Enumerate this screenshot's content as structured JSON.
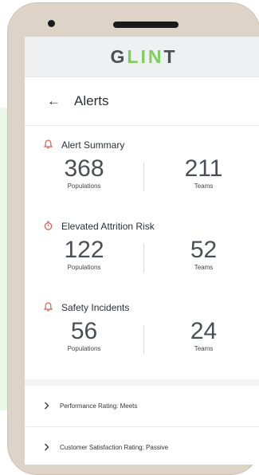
{
  "brand": {
    "logo": "GLINT"
  },
  "header": {
    "back_icon": "←",
    "title": "Alerts"
  },
  "sections": [
    {
      "title": "Alert Summary",
      "icon": "bell-icon",
      "populations": "368",
      "populations_label": "Populations",
      "teams": "211",
      "teams_label": "Teams"
    },
    {
      "title": "Elevated Attrition Risk",
      "icon": "stopwatch-icon",
      "populations": "122",
      "populations_label": "Populations",
      "teams": "52",
      "teams_label": "Teams"
    },
    {
      "title": "Safety Incidents",
      "icon": "bell-icon",
      "populations": "56",
      "populations_label": "Populations",
      "teams": "24",
      "teams_label": "Teams"
    }
  ],
  "rows": [
    {
      "label": "Performance Rating: Meets"
    },
    {
      "label": "Customer Satisfaction Rating: Passive"
    }
  ],
  "colors": {
    "accent_red": "#e05a4e",
    "logo_green": "#7ccf5a",
    "phone_body": "#ddd3c6"
  }
}
